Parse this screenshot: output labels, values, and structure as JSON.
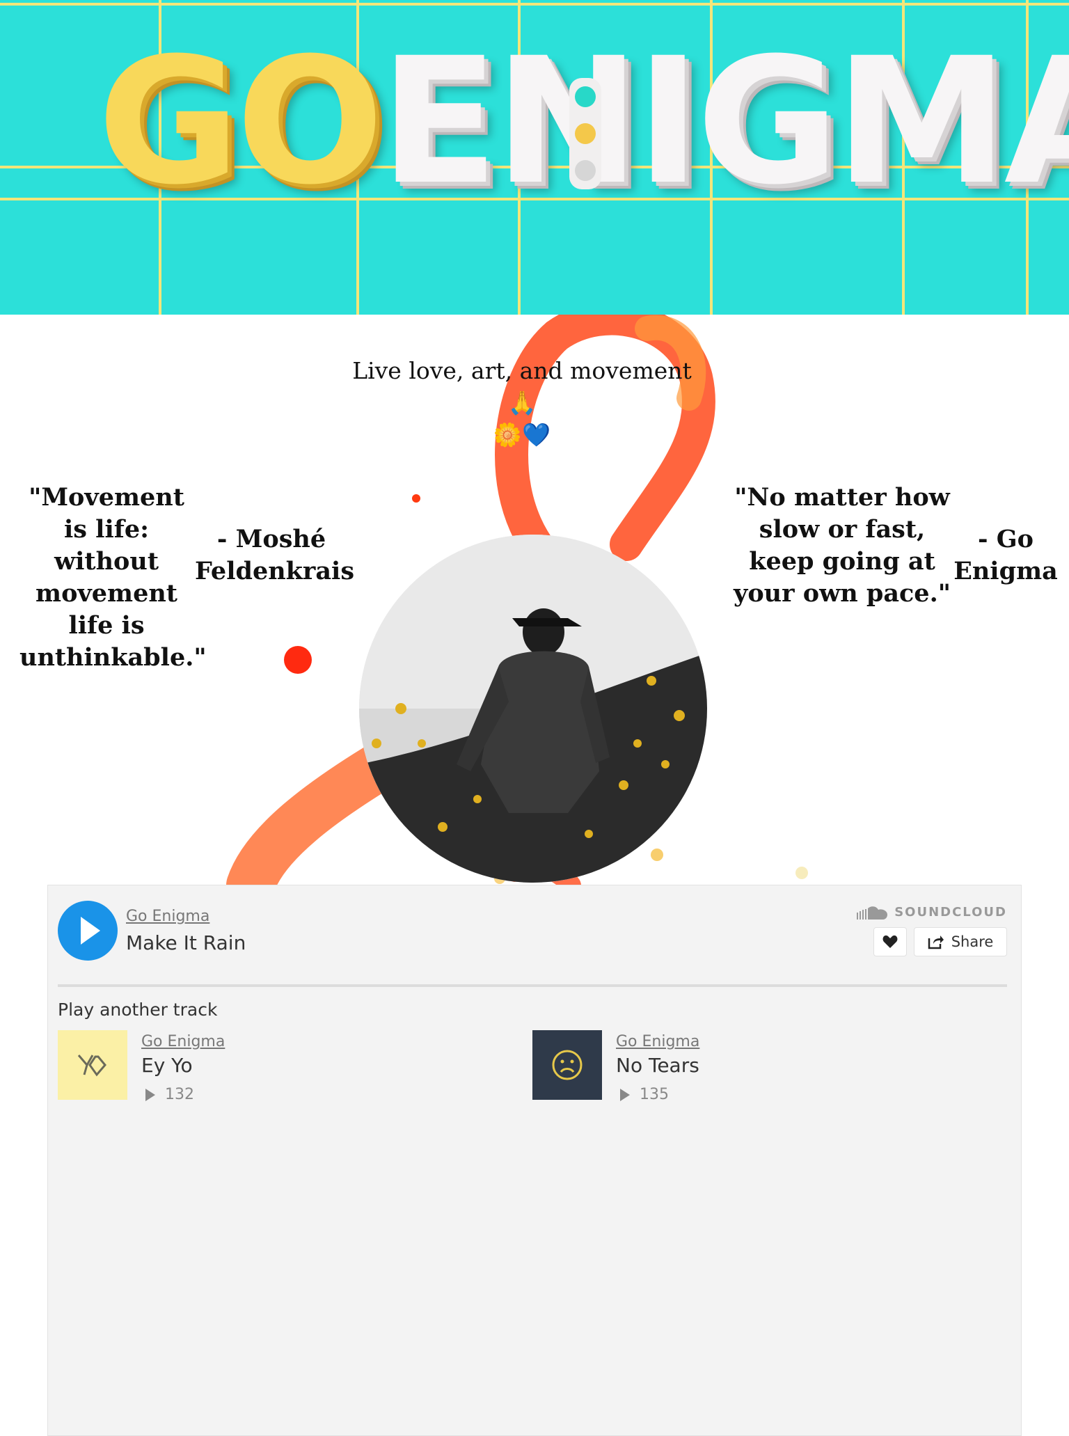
{
  "banner": {
    "logo_go": "GO",
    "logo_rest": "ENIGMA",
    "colors": {
      "background": "#2ce0d9",
      "grid": "#f3e67a",
      "go": "#f8d85a",
      "rest": "#f7f5f6"
    }
  },
  "hero": {
    "tagline": "Live love, art, and movement 🙏",
    "tagline_emojis": "🌼💙",
    "quote_left": "\"Movement is life: without movement life is unthinkable.\"",
    "attribution_left": "- Moshé Feldenkrais",
    "quote_right": "\"No matter how slow or fast, keep going at your own pace.\"",
    "attribution_right": "- Go Enigma",
    "colors": {
      "splash": "#ff4a1c",
      "splash_light": "#ff9a3c"
    }
  },
  "player": {
    "artist": "Go Enigma",
    "track": "Make It Rain",
    "brand": "SOUNDCLOUD",
    "like_icon": "heart-icon",
    "share_label": "Share",
    "accent": "#1a93e8",
    "section_label": "Play another track",
    "tracks": [
      {
        "artist": "Go Enigma",
        "title": "Ey Yo",
        "plays": "132",
        "art_bg": "#fbf0a6",
        "art_icon": "yo-logo-icon"
      },
      {
        "artist": "Go Enigma",
        "title": "No Tears",
        "plays": "135",
        "art_bg": "#2f3a4a",
        "art_icon": "sad-face-icon"
      }
    ]
  }
}
